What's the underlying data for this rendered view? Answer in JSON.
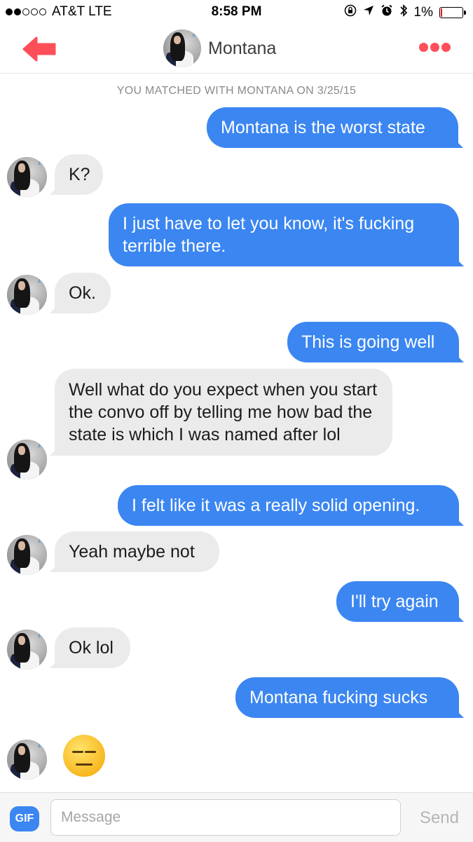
{
  "status_bar": {
    "carrier": "AT&T  LTE",
    "time": "8:58 PM",
    "battery_percent": "1%",
    "signal_bars_filled": 2,
    "signal_bars_total": 5,
    "icons": [
      "lock-rotation-icon",
      "location-arrow-icon",
      "alarm-icon",
      "bluetooth-icon",
      "battery-icon"
    ]
  },
  "header": {
    "title": "Montana",
    "back_icon": "arrow-left-icon",
    "more_icon": "more-dots-icon",
    "accent_color": "#fe4f59"
  },
  "match_banner": "YOU MATCHED WITH MONTANA ON 3/25/15",
  "messages": [
    {
      "from": "me",
      "text": "Montana is the worst state"
    },
    {
      "from": "them",
      "text": "K?"
    },
    {
      "from": "me",
      "text": "I just have to let you know, it's fucking terrible there."
    },
    {
      "from": "them",
      "text": "Ok."
    },
    {
      "from": "me",
      "text": "This is going well"
    },
    {
      "from": "them",
      "text": "Well what do you expect when you start the convo off by telling me how bad the state is which I was named after lol"
    },
    {
      "from": "me",
      "text": "I felt like it was a really solid opening."
    },
    {
      "from": "them",
      "text": "Yeah maybe not"
    },
    {
      "from": "me",
      "text": "I'll try again"
    },
    {
      "from": "them",
      "text": "Ok lol"
    },
    {
      "from": "me",
      "text": "Montana fucking sucks"
    },
    {
      "from": "them",
      "emoji": "expressionless-face"
    }
  ],
  "composer": {
    "gif_label": "GIF",
    "placeholder": "Message",
    "value": "",
    "send_label": "Send"
  },
  "colors": {
    "outgoing_bubble": "#3b86f1",
    "incoming_bubble": "#ebebeb",
    "brand": "#fe4f59"
  }
}
